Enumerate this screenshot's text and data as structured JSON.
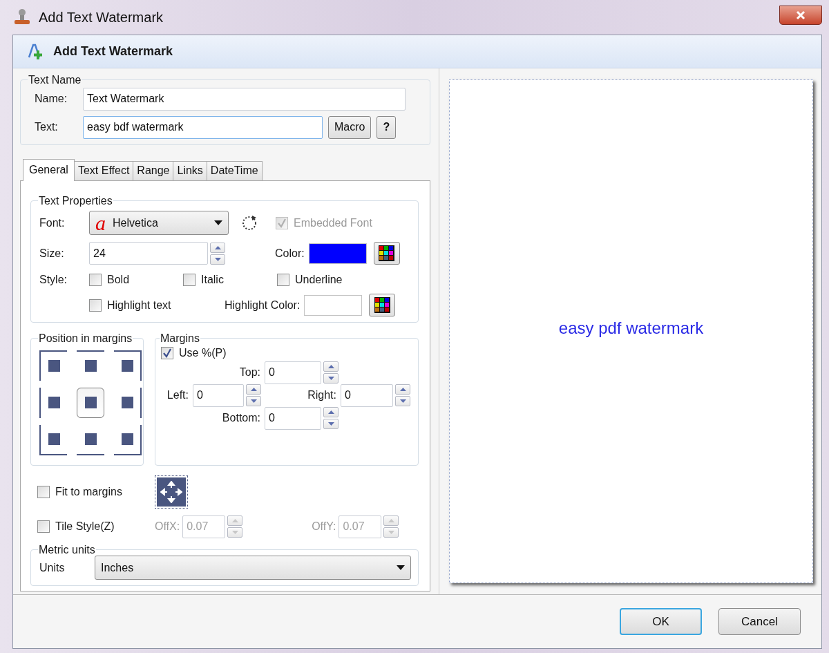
{
  "window": {
    "title": "Add Text Watermark"
  },
  "header": {
    "title": "Add Text Watermark"
  },
  "text_name": {
    "legend": "Text Name",
    "name": {
      "label": "Name:",
      "value": "Text Watermark"
    },
    "text": {
      "label": "Text:",
      "value": "easy bdf watermark"
    },
    "buttons": [
      "Macro",
      "?"
    ]
  },
  "tabs": [
    {
      "label": "General",
      "selected": true
    },
    {
      "label": "Text Effect",
      "selected": false
    },
    {
      "label": "Range",
      "selected": false
    },
    {
      "label": "Links",
      "selected": false
    },
    {
      "label": "DateTime",
      "selected": false
    }
  ],
  "text_properties": {
    "legend": "Text Properties",
    "font": {
      "label": "Font:",
      "icon_glyph": "a",
      "value": "Helvetica"
    },
    "embedded_font": {
      "label": "Embedded Font",
      "checked": true,
      "disabled": true
    },
    "size": {
      "label": "Size:",
      "value": "24"
    },
    "color": {
      "label": "Color:",
      "color": "#0000ff"
    },
    "style_label": "Style:",
    "styles": [
      {
        "label": "Bold",
        "checked": false
      },
      {
        "label": "Italic",
        "checked": false
      },
      {
        "label": "Underline",
        "checked": false
      }
    ],
    "highlight": {
      "label": "Highlight text",
      "checked": false
    },
    "highlight_color": {
      "label": "Highlight Color:"
    }
  },
  "position": {
    "legend": "Position in margins",
    "cells": [
      {
        "selected": false
      },
      {
        "selected": false
      },
      {
        "selected": false
      },
      {
        "selected": false
      },
      {
        "selected": true
      },
      {
        "selected": false
      },
      {
        "selected": false
      },
      {
        "selected": false
      },
      {
        "selected": false
      }
    ]
  },
  "margins": {
    "legend": "Margins",
    "use_percent": {
      "label": "Use %(P)",
      "checked": true
    },
    "top": {
      "label": "Top:",
      "value": "0"
    },
    "left": {
      "label": "Left:",
      "value": "0"
    },
    "right": {
      "label": "Right:",
      "value": "0"
    },
    "bottom": {
      "label": "Bottom:",
      "value": "0"
    }
  },
  "fit_to_margins": {
    "label": "Fit to margins",
    "checked": false
  },
  "tile_style": {
    "label": "Tile Style(Z)",
    "checked": false
  },
  "offsets": [
    {
      "label": "OffX:",
      "value": "0.07",
      "disabled": true
    },
    {
      "label": "OffY:",
      "value": "0.07",
      "disabled": true
    }
  ],
  "metric_units": {
    "legend": "Metric units",
    "label": "Units",
    "value": "Inches"
  },
  "preview": {
    "text": "easy pdf watermark"
  },
  "buttons": [
    {
      "label": "OK",
      "default": true
    },
    {
      "label": "Cancel",
      "default": false
    }
  ]
}
